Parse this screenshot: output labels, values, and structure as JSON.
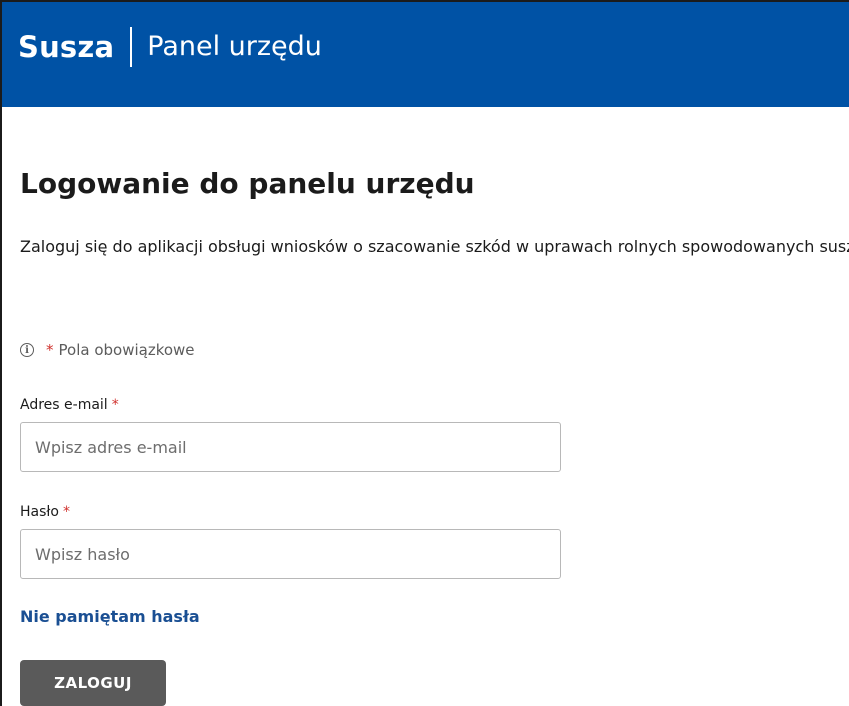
{
  "header": {
    "brand": "Susza",
    "app_name": "Panel urzędu",
    "background_color": "#0052a5"
  },
  "page": {
    "title": "Logowanie do panelu urzędu",
    "intro": "Zaloguj się do aplikacji obsługi wniosków o szacowanie szkód w uprawach rolnych spowodowanych suszą."
  },
  "required_note": {
    "icon": "info-icon",
    "asterisk": "*",
    "text": "Pola obowiązkowe"
  },
  "form": {
    "email": {
      "label": "Adres e-mail",
      "required_marker": "*",
      "value": "",
      "placeholder": "Wpisz adres e-mail"
    },
    "password": {
      "label": "Hasło",
      "required_marker": "*",
      "value": "",
      "placeholder": "Wpisz hasło"
    },
    "forgot_link": "Nie pamiętam hasła",
    "submit_label": "ZALOGUJ"
  },
  "colors": {
    "accent": "#0052a5",
    "link": "#1a4f93",
    "required": "#d0312d",
    "button": "#5a5a5a"
  }
}
